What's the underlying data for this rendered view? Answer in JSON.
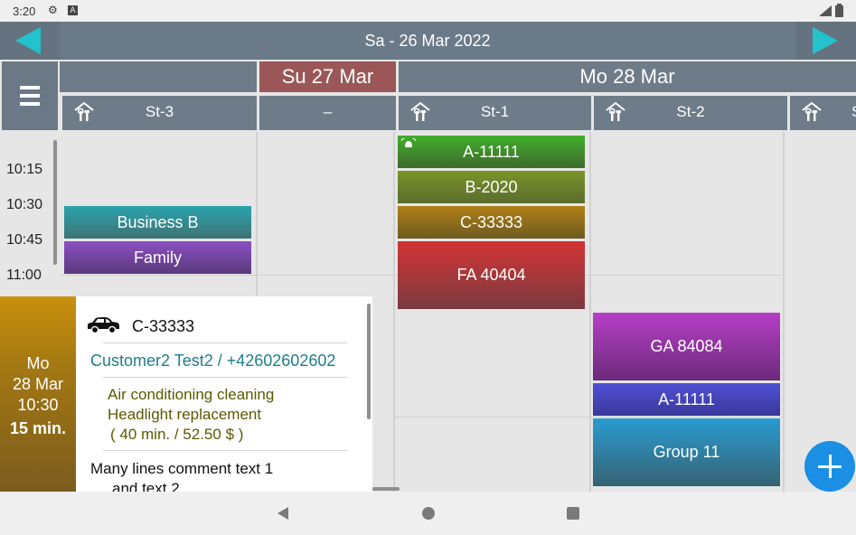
{
  "status_bar": {
    "time": "3:20",
    "icons": [
      "settings-icon",
      "a-box-icon",
      "signal-icon",
      "battery-icon"
    ]
  },
  "header": {
    "title": "Sa - 26 Mar 2022",
    "prev_icon": "left-triangle-icon",
    "next_icon": "right-triangle-icon",
    "menu_icon": "hamburger-menu-icon"
  },
  "days": [
    {
      "label": "Su   27 Mar",
      "color": "#9b5757"
    },
    {
      "label": "Mo   28 Mar",
      "color": "#6e7b88"
    }
  ],
  "stations": [
    {
      "label": "St-3",
      "has_icon": true
    },
    {
      "label": "–",
      "has_icon": false
    },
    {
      "label": "St-1",
      "has_icon": true
    },
    {
      "label": "St-2",
      "has_icon": true
    },
    {
      "label": "S",
      "has_icon": true
    }
  ],
  "time_labels": [
    "10:15",
    "10:30",
    "10:45",
    "11:00"
  ],
  "events": [
    {
      "label": "Business B",
      "color_top": "#2aa3ad",
      "color_bottom": "#3e7375"
    },
    {
      "label": "Family",
      "color_top": "#8a4fc2",
      "color_bottom": "#5b3a7c"
    },
    {
      "label": "A-11111",
      "color_top": "#3fae2a",
      "color_bottom": "#3f6a2e",
      "icon": "alarm-bell-icon"
    },
    {
      "label": "B-2020",
      "color_top": "#7b9428",
      "color_bottom": "#5b6c2f"
    },
    {
      "label": "C-33333",
      "color_top": "#b07f14",
      "color_bottom": "#6e5b22"
    },
    {
      "label": "FA 40404",
      "color_top": "#d33434",
      "color_bottom": "#7a3a40"
    },
    {
      "label": "GA 84084",
      "color_top": "#b73fc8",
      "color_bottom": "#6c2a7a"
    },
    {
      "label": "A-11111",
      "color_top": "#5151d6",
      "color_bottom": "#39379a"
    },
    {
      "label": "Group 11",
      "color_top": "#2a9bd1",
      "color_bottom": "#356373"
    }
  ],
  "popup": {
    "day": "Mo",
    "date": "28 Mar",
    "time": "10:30",
    "duration": "15 min.",
    "car_icon": "car-icon",
    "plate": "C-33333",
    "customer": "Customer2 Test2 / +42602602602",
    "service1": "Air conditioning cleaning",
    "service2": "Headlight replacement",
    "totals": "( 40 min. / 52.50 $ )",
    "comment1": "Many lines comment text 1",
    "comment2": "and text 2"
  },
  "fab_icon": "plus-icon",
  "bottom_nav": {
    "back": "back-triangle-icon",
    "home": "home-circle-icon",
    "recent": "recent-square-icon"
  }
}
